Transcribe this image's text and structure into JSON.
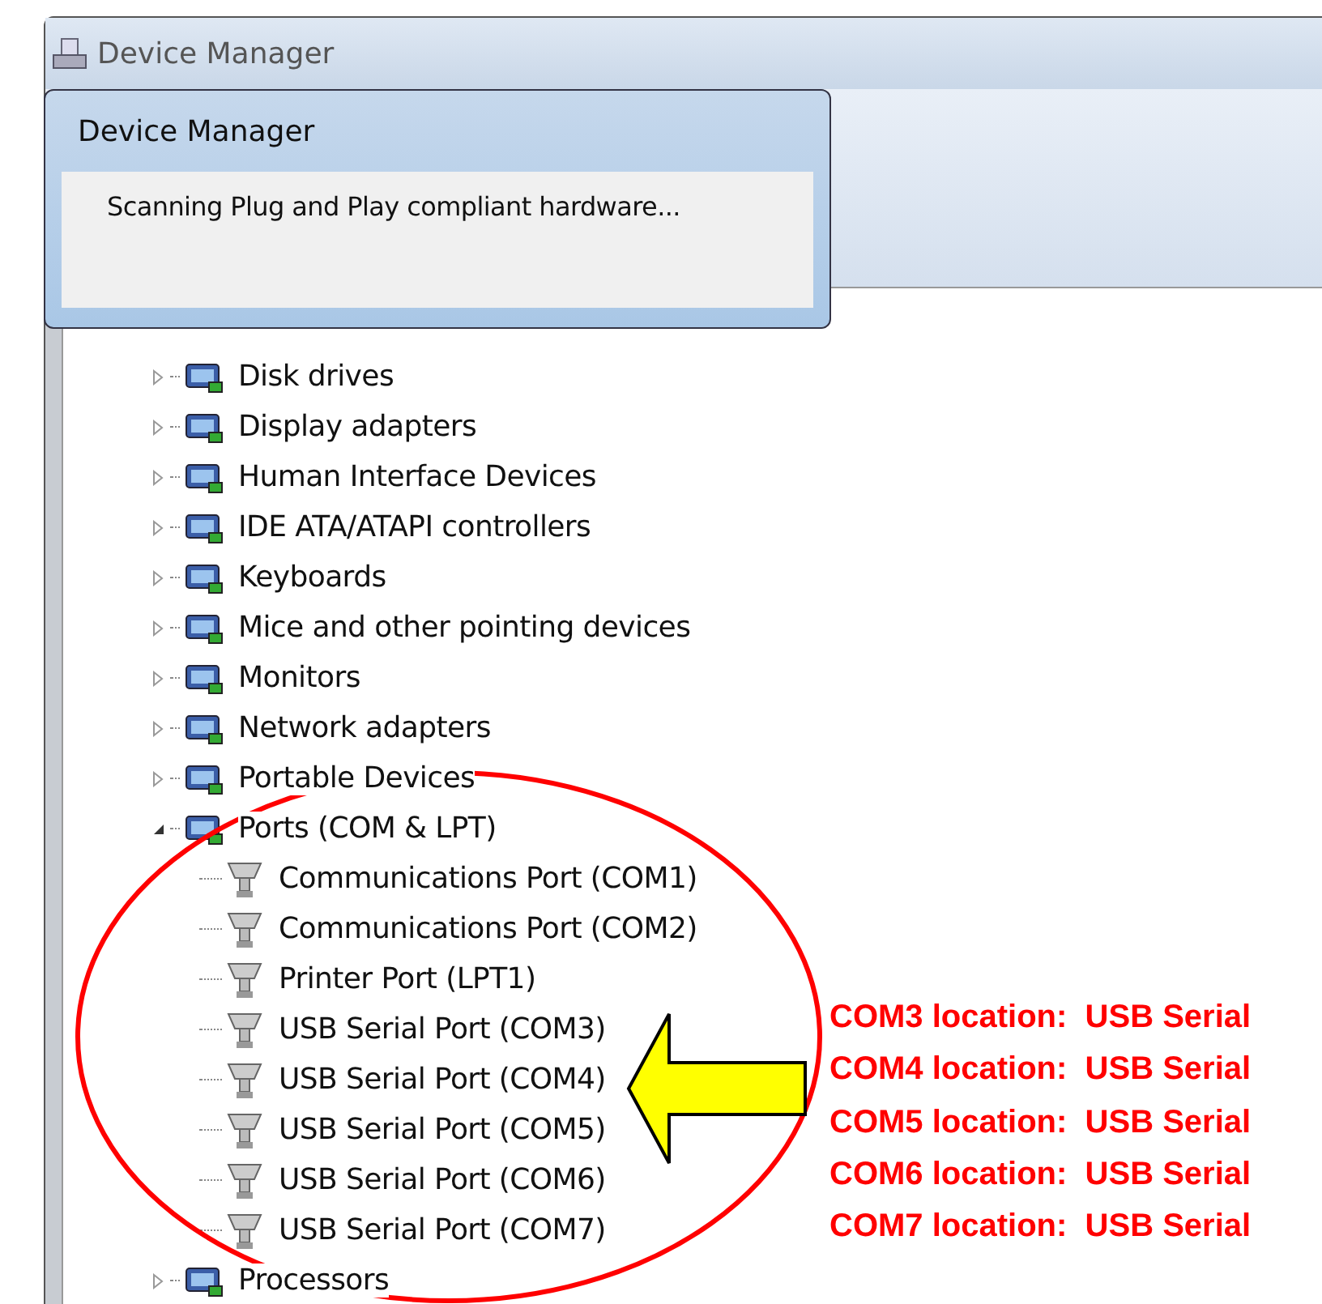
{
  "window": {
    "title": "Device Manager"
  },
  "dialog": {
    "title": "Device Manager",
    "message": "Scanning Plug and Play compliant hardware..."
  },
  "tree": [
    {
      "label": "Disk drives",
      "expanded": false
    },
    {
      "label": "Display adapters",
      "expanded": false
    },
    {
      "label": "Human Interface Devices",
      "expanded": false
    },
    {
      "label": "IDE ATA/ATAPI controllers",
      "expanded": false
    },
    {
      "label": "Keyboards",
      "expanded": false
    },
    {
      "label": "Mice and other pointing devices",
      "expanded": false
    },
    {
      "label": "Monitors",
      "expanded": false
    },
    {
      "label": "Network adapters",
      "expanded": false
    },
    {
      "label": "Portable Devices",
      "expanded": false
    },
    {
      "label": "Ports (COM & LPT)",
      "expanded": true,
      "children": [
        {
          "label": "Communications Port (COM1)"
        },
        {
          "label": "Communications Port (COM2)"
        },
        {
          "label": "Printer Port (LPT1)"
        },
        {
          "label": "USB Serial Port (COM3)"
        },
        {
          "label": "USB Serial Port (COM4)"
        },
        {
          "label": "USB Serial Port (COM5)"
        },
        {
          "label": "USB Serial Port (COM6)"
        },
        {
          "label": "USB Serial Port (COM7)"
        }
      ]
    },
    {
      "label": "Processors",
      "expanded": false
    }
  ],
  "annotations": [
    "COM3 location:  USB Serial",
    "COM4 location:  USB Serial",
    "COM5 location:  USB Serial",
    "COM6 location:  USB Serial",
    "COM7 location:  USB Serial"
  ]
}
